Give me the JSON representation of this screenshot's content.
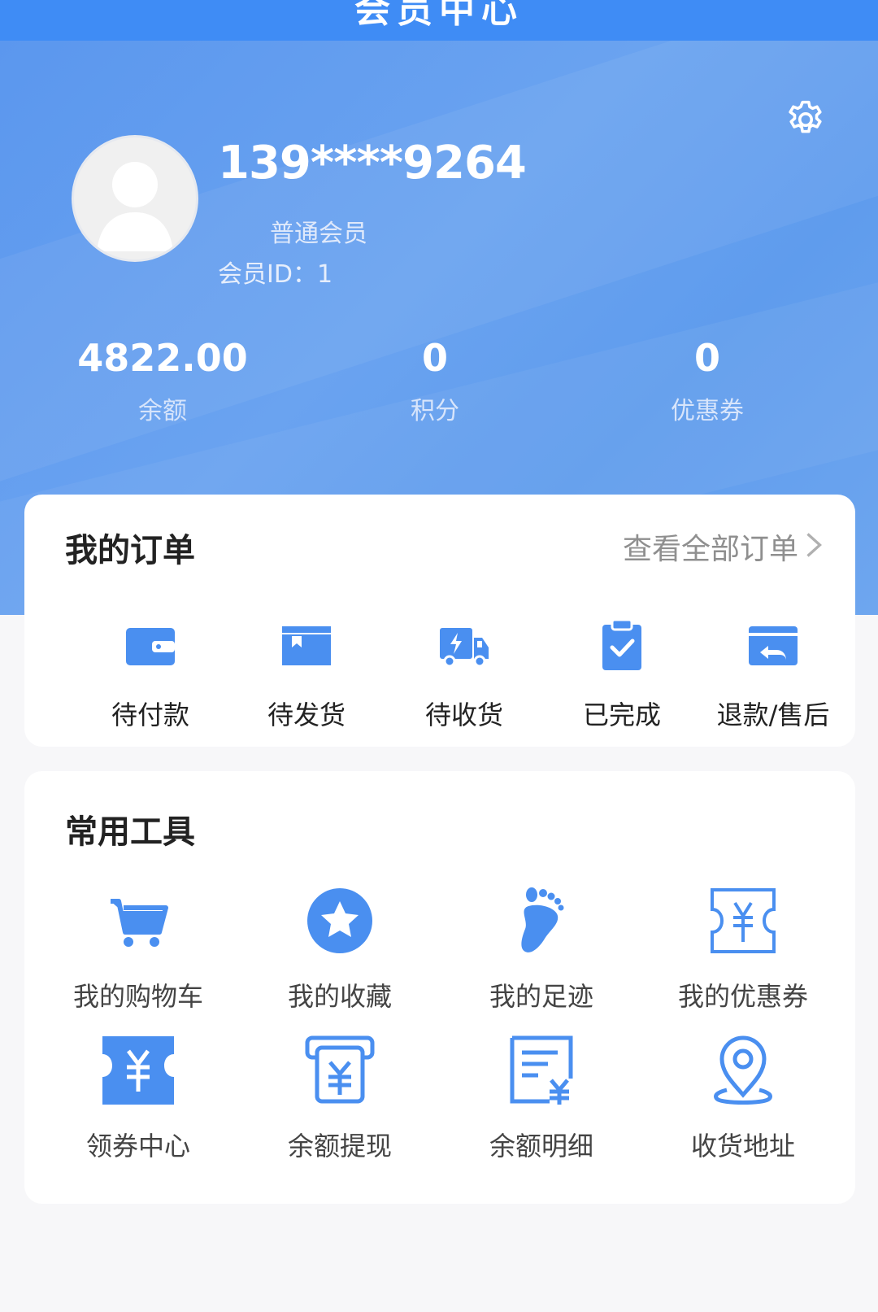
{
  "header": {
    "title": "会员中心"
  },
  "profile": {
    "phone": "139****9264",
    "level": "普通会员",
    "member_id_text": "会员ID：1"
  },
  "stats": [
    {
      "value": "4822.00",
      "label": "余额"
    },
    {
      "value": "0",
      "label": "积分"
    },
    {
      "value": "0",
      "label": "优惠券"
    }
  ],
  "orders": {
    "title": "我的订单",
    "view_all": "查看全部订单",
    "items": [
      {
        "label": "待付款",
        "icon": "wallet-icon"
      },
      {
        "label": "待发货",
        "icon": "package-icon"
      },
      {
        "label": "待收货",
        "icon": "delivery-truck-icon"
      },
      {
        "label": "已完成",
        "icon": "clipboard-check-icon"
      },
      {
        "label": "退款/售后",
        "icon": "refund-icon"
      }
    ]
  },
  "tools": {
    "title": "常用工具",
    "items": [
      {
        "label": "我的购物车",
        "icon": "cart-icon"
      },
      {
        "label": "我的收藏",
        "icon": "star-icon"
      },
      {
        "label": "我的足迹",
        "icon": "footprint-icon"
      },
      {
        "label": "我的优惠券",
        "icon": "coupon-icon"
      },
      {
        "label": "领券中心",
        "icon": "coupon-center-icon"
      },
      {
        "label": "余额提现",
        "icon": "withdraw-icon"
      },
      {
        "label": "余额明细",
        "icon": "balance-detail-icon"
      },
      {
        "label": "收货地址",
        "icon": "location-pin-icon"
      }
    ]
  },
  "colors": {
    "primary": "#4a8ff0",
    "hero": "#5f9ced",
    "page_bg": "#f7f7f9"
  }
}
